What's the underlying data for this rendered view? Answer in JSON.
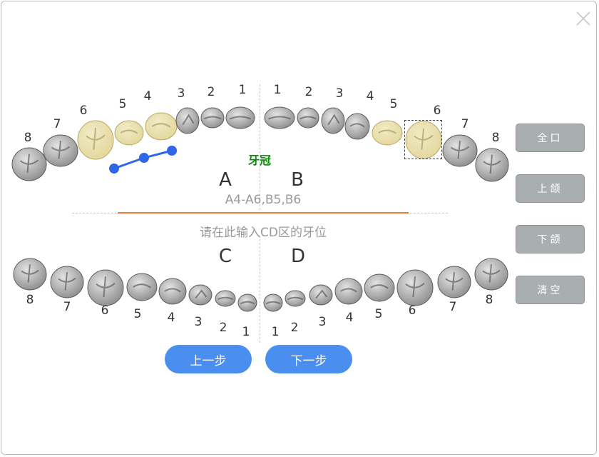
{
  "upper": {
    "left": [
      {
        "n": "8"
      },
      {
        "n": "7"
      },
      {
        "n": "6"
      },
      {
        "n": "5"
      },
      {
        "n": "4"
      },
      {
        "n": "3"
      },
      {
        "n": "2"
      },
      {
        "n": "1"
      }
    ],
    "right": [
      {
        "n": "1"
      },
      {
        "n": "2"
      },
      {
        "n": "3"
      },
      {
        "n": "4"
      },
      {
        "n": "5"
      },
      {
        "n": "6"
      },
      {
        "n": "7"
      },
      {
        "n": "8"
      }
    ]
  },
  "lower": {
    "left": [
      {
        "n": "8"
      },
      {
        "n": "7"
      },
      {
        "n": "6"
      },
      {
        "n": "5"
      },
      {
        "n": "4"
      },
      {
        "n": "3"
      },
      {
        "n": "2"
      },
      {
        "n": "1"
      }
    ],
    "right": [
      {
        "n": "1"
      },
      {
        "n": "2"
      },
      {
        "n": "3"
      },
      {
        "n": "4"
      },
      {
        "n": "5"
      },
      {
        "n": "6"
      },
      {
        "n": "7"
      },
      {
        "n": "8"
      }
    ]
  },
  "quadrants": {
    "a": "A",
    "b": "B",
    "c": "C",
    "d": "D"
  },
  "restoration_label": "牙冠",
  "selected_teeth_text": "A4-A6,B5,B6",
  "input_hint": "请在此输入CD区的牙位",
  "buttons": {
    "full_mouth": "全口",
    "upper_jaw": "上颌",
    "lower_jaw": "下颌",
    "clear": "清空",
    "prev": "上一步",
    "next": "下一步"
  },
  "colors": {
    "accent_blue": "#4a8ef0",
    "selected_tooth": "#e3d79c",
    "tooth_gray": "#8c8c8c",
    "label_green": "#10880e",
    "divider_orange": "#f0743e",
    "side_button": "#a9aeb1"
  },
  "icons": {
    "close": "close-icon",
    "tool": "bridge-connector-icon"
  },
  "selected": [
    "A4",
    "A5",
    "A6",
    "B5",
    "B6"
  ]
}
